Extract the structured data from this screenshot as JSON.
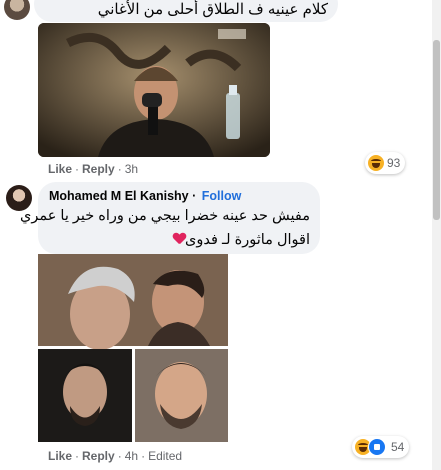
{
  "comment_top": {
    "text": "كلام عينيه ف الطلاق أحلى من الأغاني",
    "actions": {
      "like": "Like",
      "reply": "Reply",
      "time": "3h"
    },
    "reaction_count": "93"
  },
  "comment_2": {
    "author": "Mohamed M El Kanishy",
    "follow": "Follow",
    "line1": "مفيش حد عينه خضرا بيجي من وراه خير يا عمري",
    "line2": "اقوال ماثورة لـ فدوى",
    "actions": {
      "like": "Like",
      "reply": "Reply",
      "time": "4h",
      "edited": "Edited"
    },
    "reaction_count": "54"
  },
  "colors": {
    "bubble": "#f0f2f5",
    "link": "#216fdb",
    "meta": "#65676b"
  },
  "icons": [
    "haha-emoji-icon",
    "like-reaction-icon",
    "heart-icon"
  ]
}
